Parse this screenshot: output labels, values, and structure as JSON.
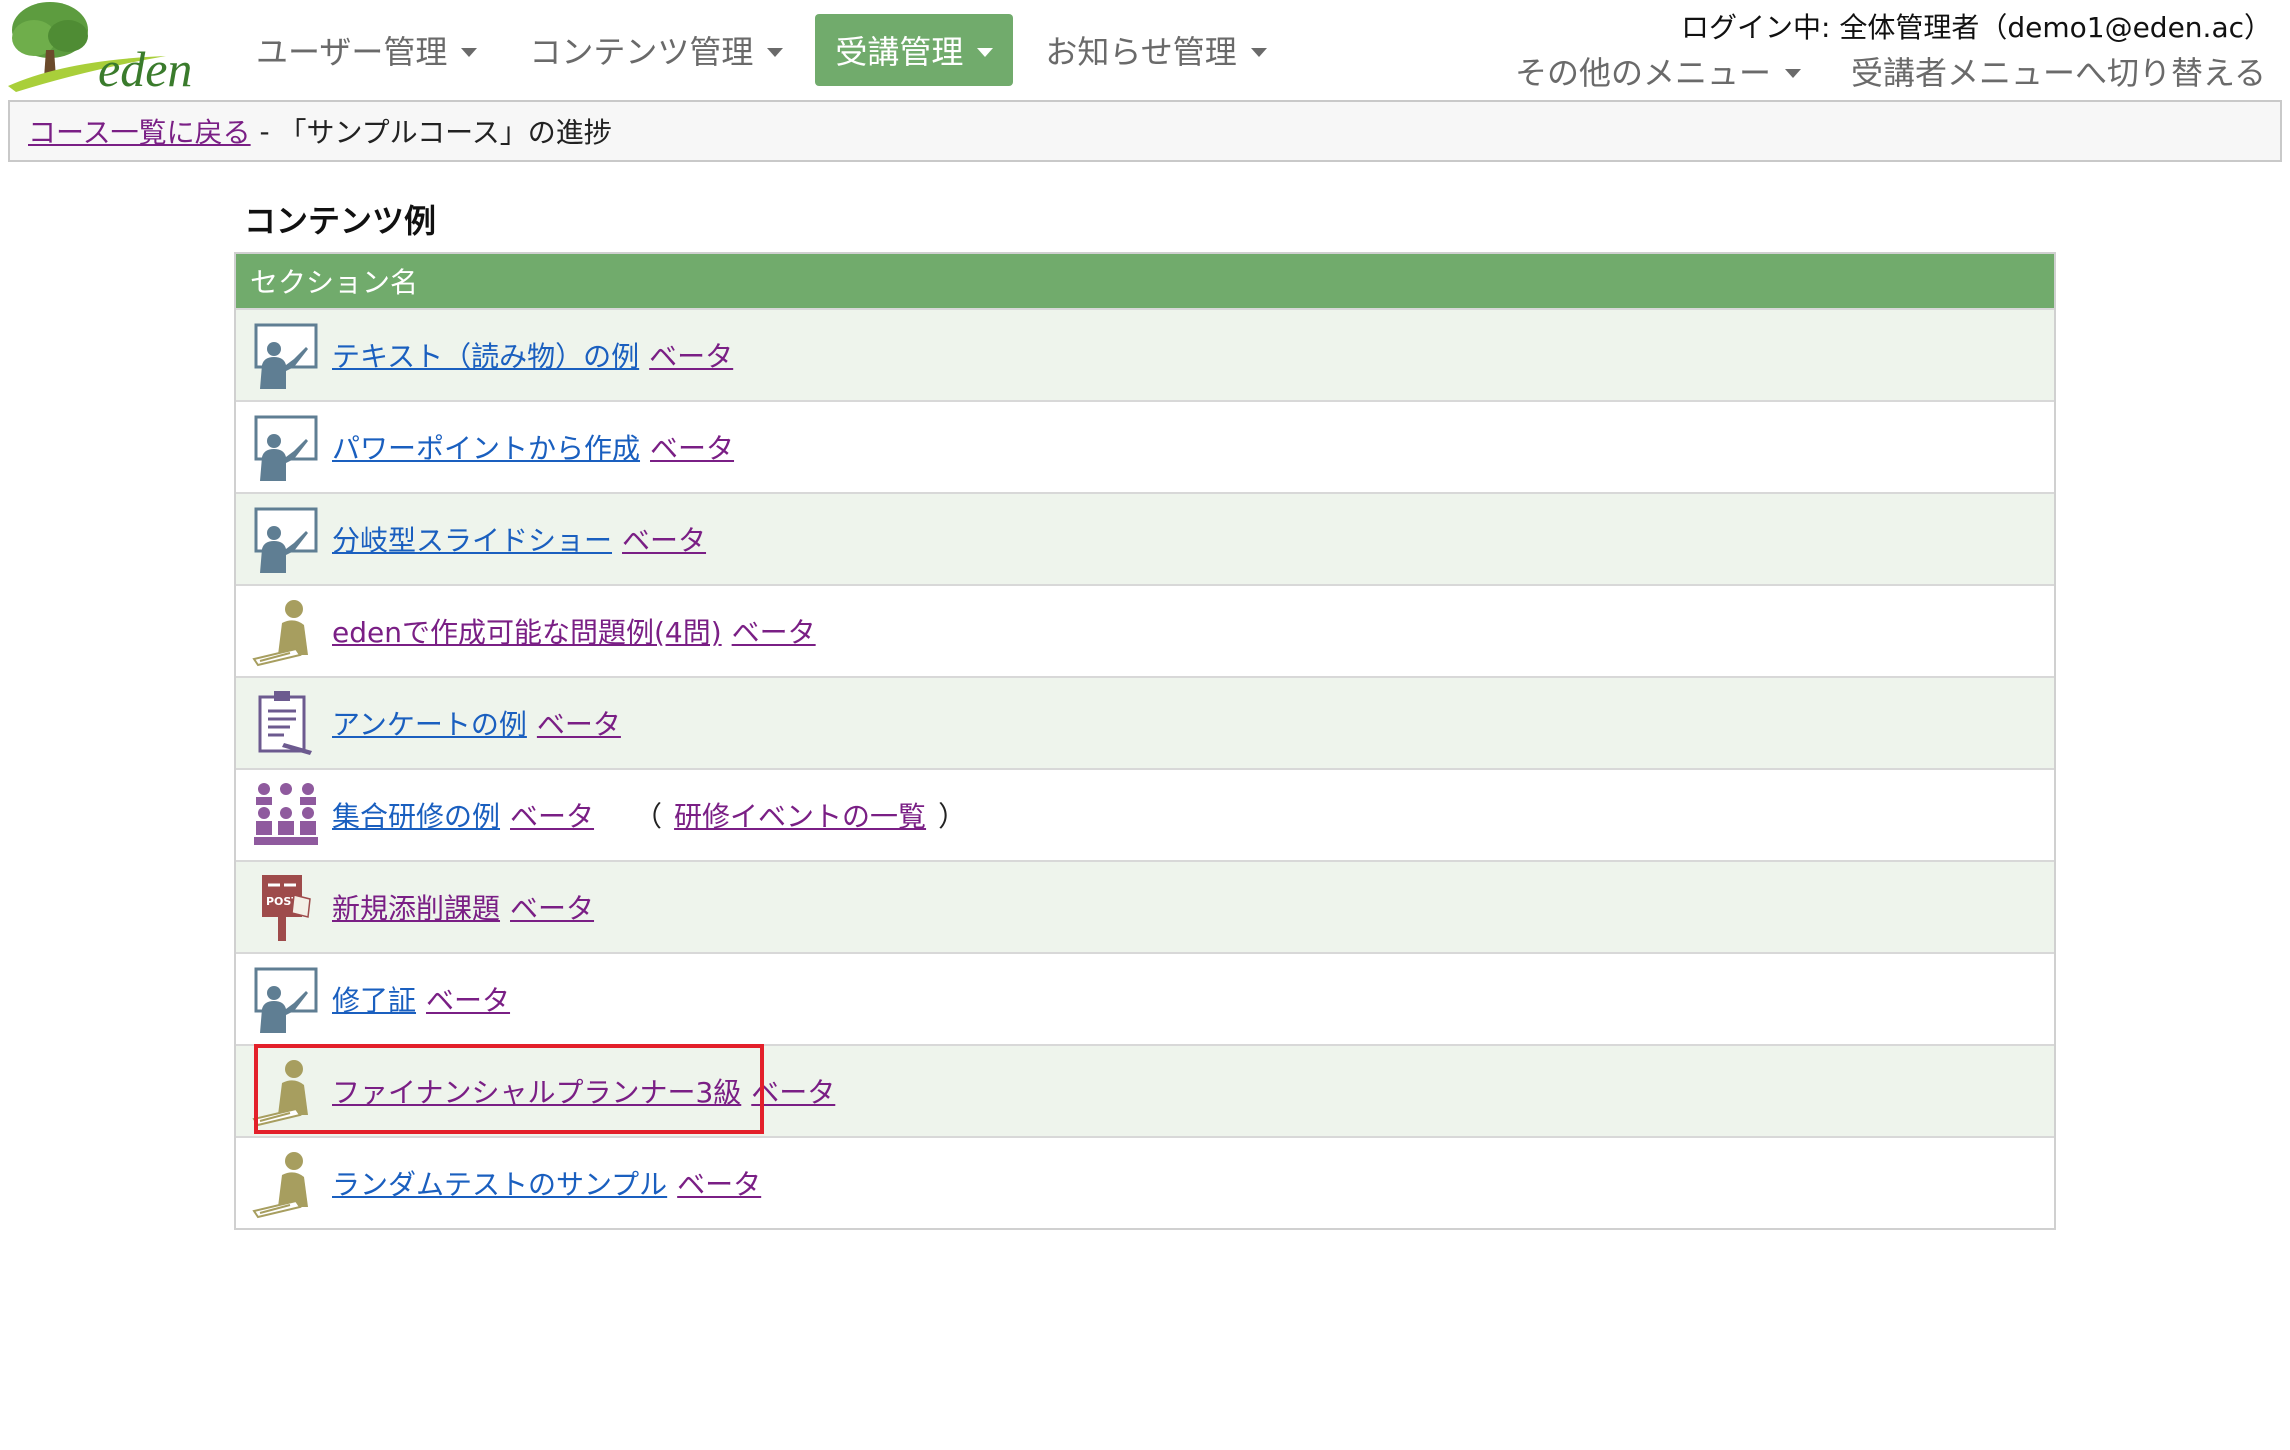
{
  "header": {
    "logo_text": "eden",
    "nav": [
      {
        "label": "ユーザー管理",
        "active": false
      },
      {
        "label": "コンテンツ管理",
        "active": false
      },
      {
        "label": "受講管理",
        "active": true
      },
      {
        "label": "お知らせ管理",
        "active": false
      }
    ],
    "login_info": "ログイン中: 全体管理者（demo1@eden.ac）",
    "other_menu": "その他のメニュー",
    "switch_menu": "受講者メニューへ切り替える"
  },
  "breadcrumb": {
    "back_link": "コース一覧に戻る",
    "separator": " - ",
    "current": "「サンプルコース」の進捗"
  },
  "main": {
    "title": "コンテンツ例",
    "table_header": "セクション名",
    "rows": [
      {
        "label": "テキスト（読み物）の例",
        "beta": "ベータ",
        "icon": "teacher-board-icon",
        "visited": false
      },
      {
        "label": "パワーポイントから作成",
        "beta": "ベータ",
        "icon": "teacher-board-icon",
        "visited": false
      },
      {
        "label": "分岐型スライドショー",
        "beta": "ベータ",
        "icon": "teacher-board-icon",
        "visited": false
      },
      {
        "label": "edenで作成可能な問題例(4問)",
        "beta": "ベータ",
        "icon": "test-taker-icon",
        "visited": true
      },
      {
        "label": "アンケートの例",
        "beta": "ベータ",
        "icon": "clipboard-survey-icon",
        "visited": false
      },
      {
        "label": "集合研修の例",
        "beta": "ベータ",
        "icon": "group-training-icon",
        "visited": false,
        "event_open": "（",
        "event_link": "研修イベントの一覧",
        "event_close": "）"
      },
      {
        "label": "新規添削課題",
        "beta": "ベータ",
        "icon": "post-box-icon",
        "visited": true
      },
      {
        "label": "修了証",
        "beta": "ベータ",
        "icon": "teacher-board-icon",
        "visited": false
      },
      {
        "label": "ファイナンシャルプランナー3級",
        "beta": "ベータ",
        "icon": "test-taker-icon",
        "visited": true,
        "highlighted": true
      },
      {
        "label": "ランダムテストのサンプル",
        "beta": "ベータ",
        "icon": "test-taker-icon",
        "visited": false
      }
    ]
  },
  "colors": {
    "accent_green": "#71ab6c",
    "link_blue": "#1a5fbf",
    "link_visited": "#7a1f85",
    "highlight_red": "#e3202a"
  }
}
